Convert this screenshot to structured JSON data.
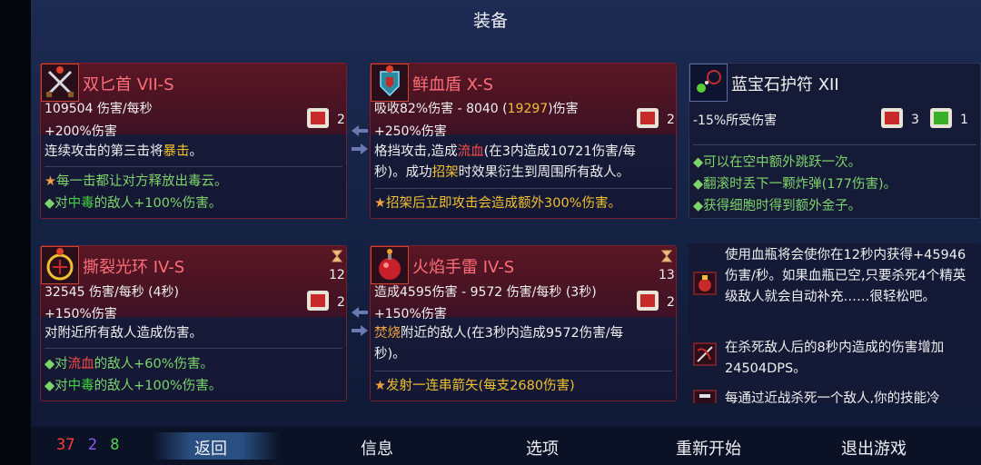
{
  "title": "装备",
  "cards": {
    "weapon1": {
      "name": "双匕首 VII-S",
      "dps": "109504 伤害/每秒",
      "bonus": "+200%伤害",
      "scroll_count": "2",
      "desc_a": "连续攻击的第三击将",
      "desc_b": "暴击",
      "desc_c": "。",
      "aff1": "每一击都让对方释放出毒云。",
      "aff2_a": "对",
      "aff2_b": "中毒",
      "aff2_c": "的敌人+100%伤害。"
    },
    "shield": {
      "name": "鲜血盾 X-S",
      "stat_a": "吸收82%伤害 - 8040 (",
      "stat_b": "19297",
      "stat_c": ")伤害",
      "bonus": "+250%伤害",
      "scroll_count": "2",
      "desc_a": "格挡攻击,造成",
      "desc_b": "流血",
      "desc_c": "(在3内造成10721伤害/每",
      "desc_d": "秒)。成功",
      "desc_e": "招架",
      "desc_f": "时效果衍生到周围所有敌人。",
      "aff1": "招架后立即攻击会造成额外300%伤害。"
    },
    "amulet": {
      "name": "蓝宝石护符 XII",
      "stat": "-15%所受伤害",
      "count_red": "3",
      "count_green": "1",
      "aff1": "可以在空中额外跳跃一次。",
      "aff2": "翻滚时丢下一颗炸弹(177伤害)。",
      "aff3": "获得细胞时得到额外金子。"
    },
    "skill1": {
      "name": "撕裂光环 IV-S",
      "cooldown": "12",
      "dps": "32545 伤害/每秒 (4秒)",
      "bonus": "+150%伤害",
      "scroll_count": "2",
      "desc": "对附近所有敌人造成伤害。",
      "aff1_a": "对",
      "aff1_b": "流血",
      "aff1_c": "的敌人+60%伤害。",
      "aff2_a": "对",
      "aff2_b": "中毒",
      "aff2_c": "的敌人+100%伤害。"
    },
    "skill2": {
      "name": "火焰手雷 IV-S",
      "cooldown": "13",
      "dps": "造成4595伤害 - 9572 伤害/每秒 (3秒)",
      "bonus": "+150%伤害",
      "scroll_count": "2",
      "desc_a": "焚烧",
      "desc_b": "附近的敌人(在3秒内造成9572伤害/每",
      "desc_c": "秒)。",
      "aff1": "发射一连串箭矢(每支2680伤害)"
    }
  },
  "mutations": [
    {
      "icon": "potion-mutation-icon",
      "text": "使用血瓶将会使你在12秒内获得+45946伤害/秒。如果血瓶已空,只要杀死4个精英级敌人就会自动补充……很轻松吧。"
    },
    {
      "icon": "bow-mutation-icon",
      "text": "在杀死敌人后的8秒内造成的伤害增加24504DPS。"
    },
    {
      "icon": "melee-mutation-icon",
      "text": "每通过近战杀死一个敌人,你的技能冷"
    }
  ],
  "stats": {
    "brutality": "37",
    "tactics": "2",
    "survival": "8"
  },
  "menu": {
    "back": "返回",
    "info": "信息",
    "options": "选项",
    "restart": "重新开始",
    "quit": "退出游戏"
  },
  "colors": {
    "brutality": "#ff3b3b",
    "tactics": "#8a5cff",
    "survival": "#4fd34f",
    "accent_red": "#ff6e78"
  }
}
